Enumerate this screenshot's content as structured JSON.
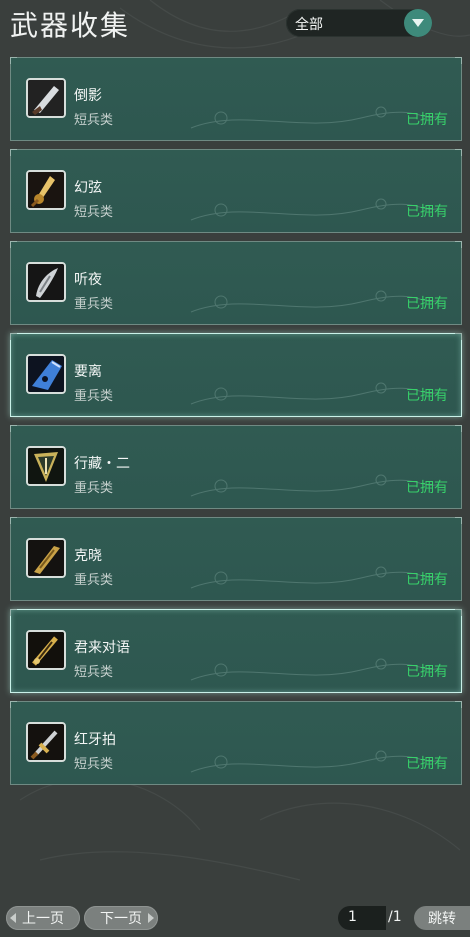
{
  "header": {
    "title": "武器收集",
    "filter_value": "全部"
  },
  "weapons": [
    {
      "name": "倒影",
      "category": "短兵类",
      "status": "已拥有",
      "selected": false,
      "icon": "dark-blade-icon"
    },
    {
      "name": "幻弦",
      "category": "短兵类",
      "status": "已拥有",
      "selected": false,
      "icon": "golden-sword-icon"
    },
    {
      "name": "听夜",
      "category": "重兵类",
      "status": "已拥有",
      "selected": false,
      "icon": "steel-blade-icon"
    },
    {
      "name": "要离",
      "category": "重兵类",
      "status": "已拥有",
      "selected": true,
      "icon": "blue-blade-icon"
    },
    {
      "name": "行藏・二",
      "category": "重兵类",
      "status": "已拥有",
      "selected": false,
      "icon": "shield-blade-icon"
    },
    {
      "name": "克晓",
      "category": "重兵类",
      "status": "已拥有",
      "selected": false,
      "icon": "bronze-blade-icon"
    },
    {
      "name": "君来对语",
      "category": "短兵类",
      "status": "已拥有",
      "selected": true,
      "icon": "ornate-sword-icon"
    },
    {
      "name": "红牙拍",
      "category": "短兵类",
      "status": "已拥有",
      "selected": false,
      "icon": "hilt-sword-icon"
    }
  ],
  "pager": {
    "prev_label": "上一页",
    "next_label": "下一页",
    "current_page": "1",
    "total_pages": "/1",
    "jump_label": "跳转"
  },
  "colors": {
    "owned": "#37d06a",
    "accent": "#3e8a7b",
    "panel": "#305b52"
  }
}
